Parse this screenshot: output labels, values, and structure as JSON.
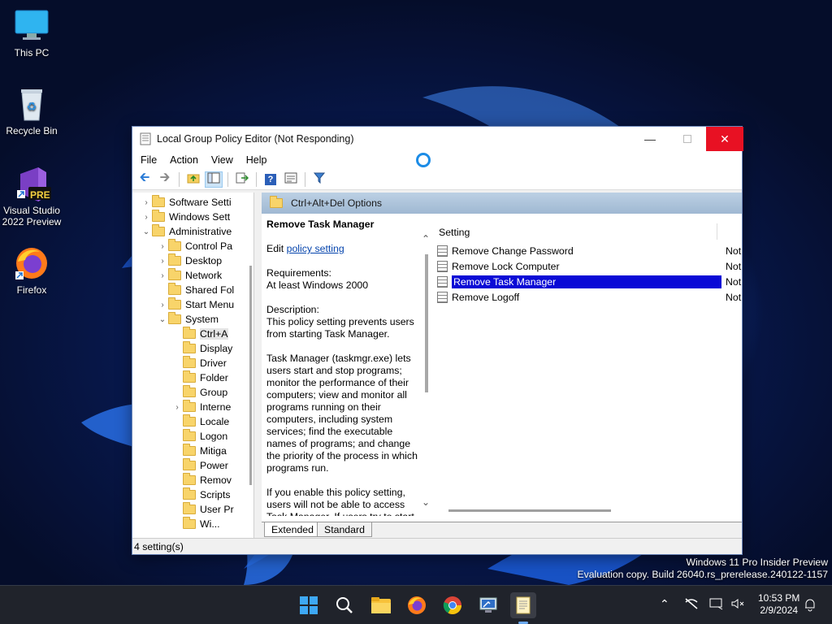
{
  "desktop": {
    "icons": [
      {
        "label": "This PC",
        "icon": "monitor-icon"
      },
      {
        "label": "Recycle Bin",
        "icon": "recycle-bin-icon"
      },
      {
        "label": "Visual Studio 2022 Preview",
        "icon": "visual-studio-icon",
        "badge": "PRE"
      },
      {
        "label": "Firefox",
        "icon": "firefox-icon"
      }
    ],
    "watermark": {
      "line1": "Windows 11 Pro Insider Preview",
      "line2": "Evaluation copy. Build 26040.rs_prerelease.240122-1157"
    }
  },
  "window": {
    "title": "Local Group Policy Editor (Not Responding)",
    "menu": [
      "File",
      "Action",
      "View",
      "Help"
    ],
    "tree": {
      "items": [
        {
          "label": "Software Setti",
          "expand": "›",
          "level": 1
        },
        {
          "label": "Windows Sett",
          "expand": "›",
          "level": 1
        },
        {
          "label": "Administrative",
          "expand": "⌄",
          "level": 1
        },
        {
          "label": "Control Pa",
          "expand": "›",
          "level": 2
        },
        {
          "label": "Desktop",
          "expand": "›",
          "level": 2
        },
        {
          "label": "Network",
          "expand": "›",
          "level": 2
        },
        {
          "label": "Shared Fol",
          "expand": "",
          "level": 2
        },
        {
          "label": "Start Menu",
          "expand": "›",
          "level": 2
        },
        {
          "label": "System",
          "expand": "⌄",
          "level": 2
        },
        {
          "label": "Ctrl+A",
          "expand": "",
          "level": 3,
          "selected": true
        },
        {
          "label": "Display",
          "expand": "",
          "level": 3
        },
        {
          "label": "Driver",
          "expand": "",
          "level": 3
        },
        {
          "label": "Folder",
          "expand": "",
          "level": 3
        },
        {
          "label": "Group",
          "expand": "",
          "level": 3
        },
        {
          "label": "Interne",
          "expand": "›",
          "level": 3
        },
        {
          "label": "Locale",
          "expand": "",
          "level": 3
        },
        {
          "label": "Logon",
          "expand": "",
          "level": 3
        },
        {
          "label": "Mitiga",
          "expand": "",
          "level": 3
        },
        {
          "label": "Power",
          "expand": "",
          "level": 3
        },
        {
          "label": "Remov",
          "expand": "",
          "level": 3
        },
        {
          "label": "Scripts",
          "expand": "",
          "level": 3
        },
        {
          "label": "User Pr",
          "expand": "",
          "level": 3
        },
        {
          "label": "Wi...",
          "expand": "",
          "level": 3
        }
      ]
    },
    "header": "Ctrl+Alt+Del Options",
    "description": {
      "title": "Remove Task Manager",
      "edit_prefix": "Edit",
      "edit_link": "policy setting",
      "requirements_label": "Requirements:",
      "requirements_value": "At least Windows 2000",
      "description_label": "Description:",
      "description_text": "This policy setting prevents users from starting Task Manager.",
      "para2": "Task Manager (taskmgr.exe) lets users start and stop programs; monitor the performance of their computers; view and monitor all programs running on their computers, including system services; find the executable names of programs; and change the priority of the process in which programs run.",
      "para3": "If you enable this policy setting, users will not be able to access Task Manager. If users try to start"
    },
    "list": {
      "column": "Setting",
      "rows": [
        {
          "name": "Remove Change Password",
          "state": "Not"
        },
        {
          "name": "Remove Lock Computer",
          "state": "Not"
        },
        {
          "name": "Remove Task Manager",
          "state": "Not",
          "selected": true
        },
        {
          "name": "Remove Logoff",
          "state": "Not"
        }
      ]
    },
    "tabs": [
      "Extended",
      "Standard"
    ],
    "status": "4 setting(s)"
  },
  "taskbar": {
    "time": "10:53 PM",
    "date": "2/9/2024",
    "apps": [
      "start-icon",
      "search-icon",
      "file-explorer-icon",
      "firefox-icon",
      "chrome-icon",
      "remote-desktop-icon",
      "notepad-icon"
    ]
  }
}
